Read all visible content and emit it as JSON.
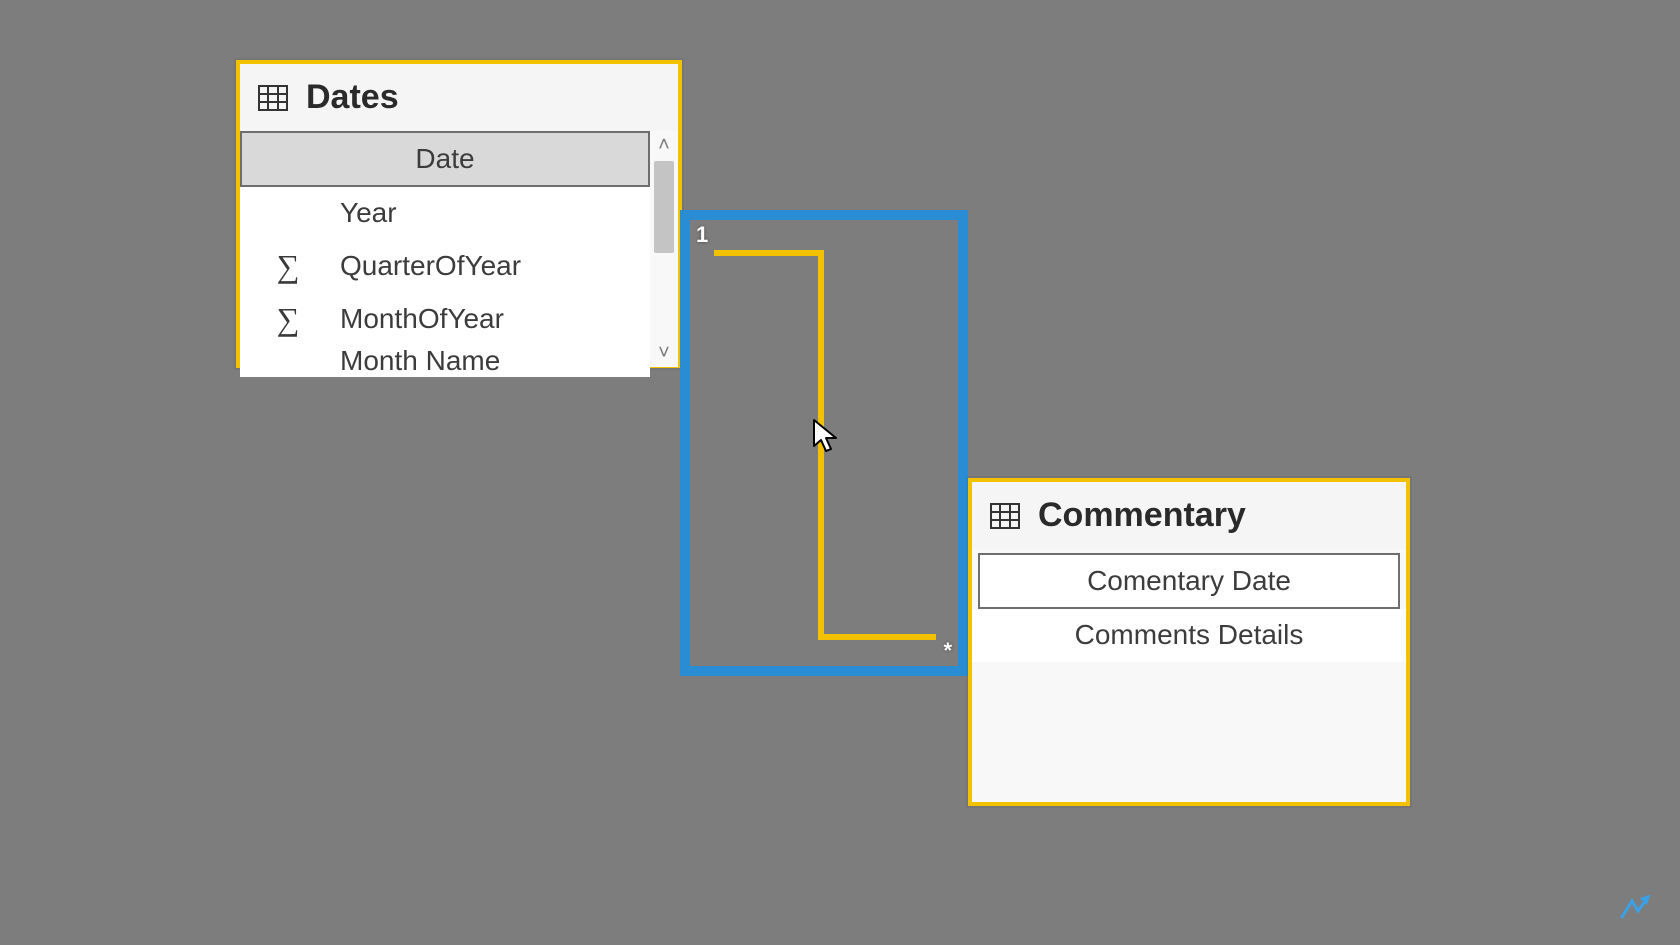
{
  "tables": {
    "dates": {
      "title": "Dates",
      "fields": {
        "date": {
          "label": "Date",
          "sigma": false,
          "selected": true
        },
        "year": {
          "label": "Year",
          "sigma": false,
          "selected": false
        },
        "quarter": {
          "label": "QuarterOfYear",
          "sigma": true,
          "selected": false
        },
        "month": {
          "label": "MonthOfYear",
          "sigma": true,
          "selected": false
        },
        "monthname": {
          "label": "Month Name",
          "sigma": false,
          "selected": false
        }
      }
    },
    "commentary": {
      "title": "Commentary",
      "fields": {
        "cdate": {
          "label": "Comentary Date",
          "sigma": false,
          "selected": false
        },
        "details": {
          "label": "Comments Details",
          "sigma": false,
          "selected": false
        }
      }
    }
  },
  "relationship": {
    "from_card": "1",
    "to_card": "*"
  },
  "colors": {
    "accent_yellow": "#f2c200",
    "accent_blue": "#2a8dd4"
  }
}
